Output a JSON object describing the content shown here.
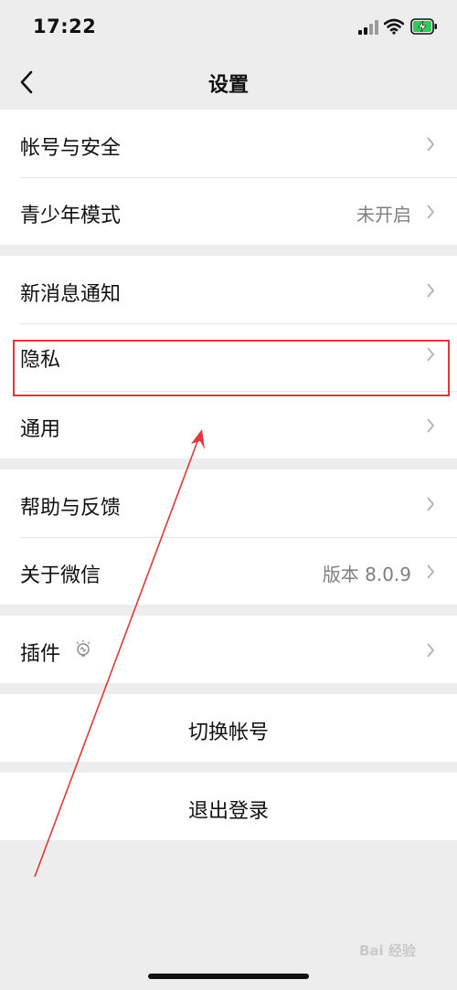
{
  "status_bar": {
    "time": "17:22"
  },
  "nav": {
    "title": "设置"
  },
  "groups": [
    {
      "items": [
        {
          "label": "帐号与安全",
          "value": ""
        },
        {
          "label": "青少年模式",
          "value": "未开启"
        }
      ]
    },
    {
      "items": [
        {
          "label": "新消息通知",
          "value": ""
        },
        {
          "label": "隐私",
          "value": ""
        },
        {
          "label": "通用",
          "value": ""
        }
      ]
    },
    {
      "items": [
        {
          "label": "帮助与反馈",
          "value": ""
        },
        {
          "label": "关于微信",
          "value": "版本 8.0.9"
        }
      ]
    },
    {
      "items": [
        {
          "label": "插件",
          "value": ""
        }
      ]
    }
  ],
  "actions": {
    "switch_account": "切换帐号",
    "logout": "退出登录"
  },
  "watermark": "Bai 经验",
  "colors": {
    "background": "#ededed",
    "highlight": "#e03838",
    "secondary_text": "#7f7f7f"
  }
}
